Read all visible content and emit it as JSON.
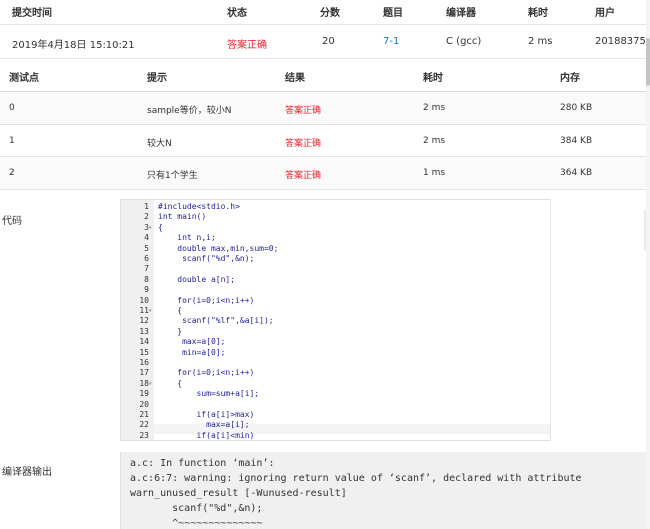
{
  "submission_table": {
    "headers": {
      "time": "提交时间",
      "status": "状态",
      "score": "分数",
      "problem": "题目",
      "compiler": "编译器",
      "duration": "耗时",
      "user": "用户"
    },
    "row": {
      "time": "2019年4月18日 15:10:21",
      "status": "答案正确",
      "score": "20",
      "problem": "7-1",
      "compiler": "C (gcc)",
      "duration": "2 ms",
      "user": "20188375"
    }
  },
  "test_table": {
    "headers": {
      "id": "测试点",
      "hint": "提示",
      "result": "结果",
      "duration": "耗时",
      "memory": "内存"
    },
    "rows": [
      {
        "id": "0",
        "hint": "sample等价，较小N",
        "result": "答案正确",
        "duration": "2 ms",
        "memory": "280 KB"
      },
      {
        "id": "1",
        "hint": "较大N",
        "result": "答案正确",
        "duration": "2 ms",
        "memory": "384 KB"
      },
      {
        "id": "2",
        "hint": "只有1个学生",
        "result": "答案正确",
        "duration": "1 ms",
        "memory": "364 KB"
      }
    ]
  },
  "code_section": {
    "label": "代码",
    "line_numbers": [
      "1",
      "2",
      "3",
      "4",
      "5",
      "6",
      "7",
      "8",
      "9",
      "10",
      "11",
      "12",
      "13",
      "14",
      "15",
      "16",
      "17",
      "18",
      "19",
      "20",
      "21",
      "22",
      "23"
    ],
    "lines": [
      "#include<stdio.h>",
      "int main()",
      "{",
      "    int n,i;",
      "    double max,min,sum=0;",
      "     scanf(\"%d\",&n);",
      "",
      "    double a[n];",
      "",
      "    for(i=0;i<n;i++)",
      "    {",
      "     scanf(\"%lf\",&a[i]);",
      "    }",
      "     max=a[0];",
      "     min=a[0];",
      "",
      "    for(i=0;i<n;i++)",
      "    {",
      "        sum=sum+a[i];",
      "",
      "        if(a[i]>max)",
      "          max=a[i];",
      "        if(a[i]<min)"
    ],
    "fold_markers": [
      "",
      "",
      "▾",
      "",
      "",
      "",
      "",
      "",
      "",
      "",
      "▾",
      "",
      "",
      "",
      "",
      "",
      "",
      "▾",
      "",
      "",
      "",
      "",
      ""
    ]
  },
  "compiler_section": {
    "label": "编译器输出",
    "lines": [
      "a.c: In function ‘main’:",
      "a.c:6:7: warning: ignoring return value of ‘scanf’, declared with attribute",
      "warn_unused_result [-Wunused-result]",
      "       scanf(\"%d\",&n);",
      "       ^~~~~~~~~~~~~~~"
    ]
  },
  "colors": {
    "accepted": "#e8262c",
    "problem_link": "#1a6fc4",
    "code_keyword": "#1f1fa0",
    "code_string": "#c52323"
  }
}
